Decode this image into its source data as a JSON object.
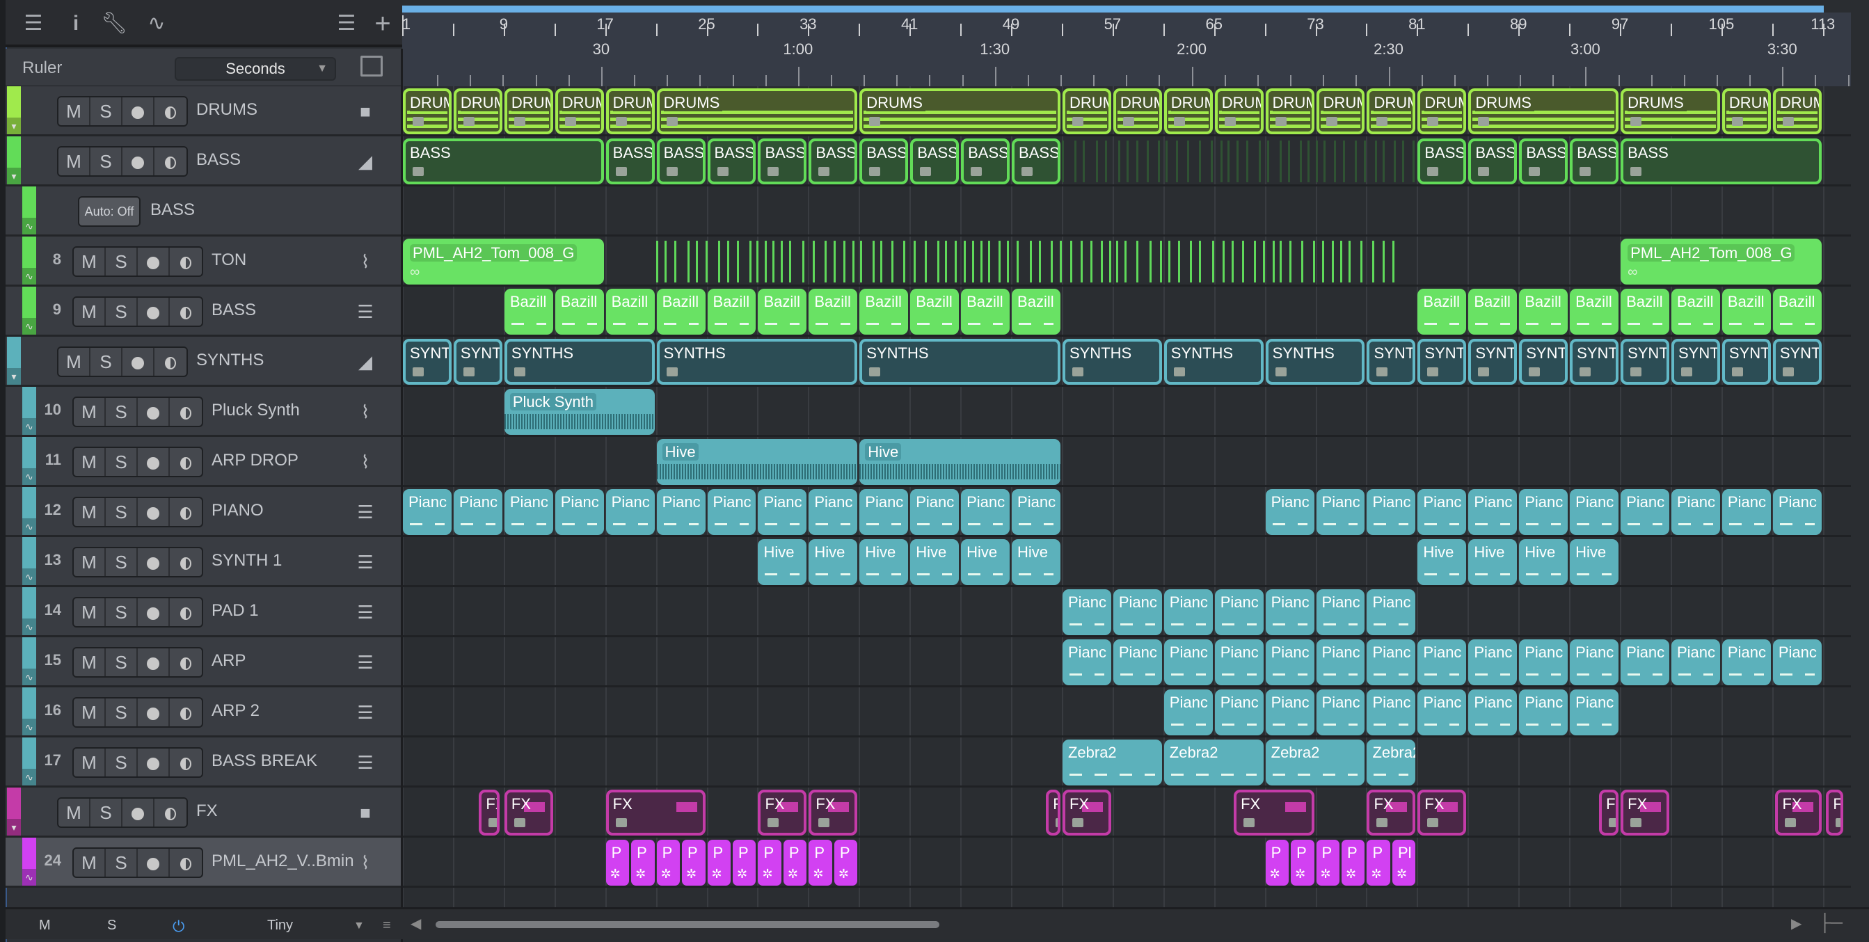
{
  "toolbar": {
    "icons": [
      "menu-icon",
      "info-icon",
      "wrench-icon",
      "automation-icon",
      "list-icon",
      "add-icon"
    ]
  },
  "ruler": {
    "label": "Ruler",
    "format": "Seconds",
    "bar_labels": [
      "1",
      "9",
      "17",
      "25",
      "33",
      "41",
      "49",
      "57",
      "65",
      "73",
      "81",
      "89",
      "97",
      "105",
      "113"
    ],
    "time_labels": [
      {
        "t": 30,
        "label": "30"
      },
      {
        "t": 60,
        "label": "1:00"
      },
      {
        "t": 90,
        "label": "1:30"
      },
      {
        "t": 120,
        "label": "2:00"
      },
      {
        "t": 150,
        "label": "2:30"
      },
      {
        "t": 180,
        "label": "3:00"
      },
      {
        "t": 210,
        "label": "3:30"
      }
    ]
  },
  "colors": {
    "drums": "#a0ea4c",
    "bass": "#62dc58",
    "synths": "#5cb1bb",
    "fx": "#c43ba8",
    "pattern": "#d241f2",
    "loop": "#6ab0e6"
  },
  "tracks": [
    {
      "name": "DRUMS",
      "kind": "folder",
      "icon": "folder-icon",
      "color": "#a0ea4c",
      "style": "c-drums",
      "clips": [
        {
          "label": "DRUMS",
          "start": 1,
          "len": 4,
          "count": 5
        },
        {
          "label": "DRUMS",
          "start": 21,
          "len": 16
        },
        {
          "label": "DRUMS",
          "start": 37,
          "len": 16
        },
        {
          "label": "DRUMS",
          "start": 53,
          "len": 4,
          "count": 8
        },
        {
          "label": "DRUMS",
          "start": 85,
          "len": 12
        },
        {
          "label": "DRUMS",
          "start": 97,
          "len": 8
        },
        {
          "label": "DRUMS",
          "start": 105,
          "len": 4,
          "count": 2
        }
      ]
    },
    {
      "name": "BASS",
      "kind": "folder",
      "icon": "folder-open-icon",
      "color": "#62dc58",
      "style": "c-bass",
      "hits": [
        53,
        81
      ],
      "clips": [
        {
          "label": "BASS",
          "start": 1,
          "len": 16
        },
        {
          "label": "BASS",
          "start": 17,
          "len": 4
        },
        {
          "label": "BASS",
          "start": 21,
          "len": 4,
          "count": 8
        },
        {
          "label": "BASS",
          "start": 81,
          "len": 4,
          "count": 4
        },
        {
          "label": "BASS",
          "start": 97,
          "len": 16
        }
      ]
    },
    {
      "name": "BASS",
      "kind": "automation",
      "auto": "Auto: Off",
      "color": "#62dc58",
      "clips": []
    },
    {
      "num": "8",
      "name": "TON",
      "kind": "child",
      "icon": "waveform-icon",
      "color": "#62dc58",
      "style": "c-tom",
      "hits": [
        21,
        80
      ],
      "clips": [
        {
          "label": "PML_AH2_Tom_008_G",
          "start": 1,
          "len": 16
        },
        {
          "label": "PML_AH2_Tom_008_G",
          "start": 97,
          "len": 16
        }
      ]
    },
    {
      "num": "9",
      "name": "BASS",
      "kind": "child",
      "icon": "keyboard-icon",
      "color": "#62dc58",
      "style": "c-ginst",
      "clips": [
        {
          "label": "Bazill",
          "start": 9,
          "len": 4,
          "count": 11
        },
        {
          "label": "Bazill",
          "start": 81,
          "len": 4,
          "count": 8
        }
      ]
    },
    {
      "name": "SYNTHS",
      "kind": "folder",
      "icon": "folder-open-icon",
      "color": "#5cb1bb",
      "style": "c-synth",
      "clips": [
        {
          "label": "SYNTHS",
          "start": 1,
          "len": 4,
          "count": 2
        },
        {
          "label": "SYNTHS",
          "start": 9,
          "len": 12
        },
        {
          "label": "SYNTHS",
          "start": 21,
          "len": 16
        },
        {
          "label": "SYNTHS",
          "start": 37,
          "len": 16
        },
        {
          "label": "SYNTHS",
          "start": 53,
          "len": 8
        },
        {
          "label": "SYNTHS",
          "start": 61,
          "len": 8
        },
        {
          "label": "SYNTHS",
          "start": 69,
          "len": 8
        },
        {
          "label": "SYNTHS",
          "start": 77,
          "len": 4,
          "count": 9
        }
      ]
    },
    {
      "num": "10",
      "name": "Pluck Synth",
      "kind": "child",
      "icon": "waveform-icon",
      "color": "#5cb1bb",
      "style": "c-taud",
      "clips": [
        {
          "label": "Pluck Synth",
          "start": 9,
          "len": 12
        }
      ]
    },
    {
      "num": "11",
      "name": "ARP DROP",
      "kind": "child",
      "icon": "waveform-icon",
      "color": "#5cb1bb",
      "style": "c-taud",
      "clips": [
        {
          "label": "Hive",
          "start": 21,
          "len": 16
        },
        {
          "label": "Hive",
          "start": 37,
          "len": 16
        }
      ]
    },
    {
      "num": "12",
      "name": "PIANO",
      "kind": "child",
      "icon": "keyboard-icon",
      "color": "#5cb1bb",
      "style": "c-tinst",
      "clips": [
        {
          "label": "Pianc",
          "start": 1,
          "len": 4,
          "count": 13
        },
        {
          "label": "Pianc",
          "start": 69,
          "len": 4,
          "count": 11
        }
      ]
    },
    {
      "num": "13",
      "name": "SYNTH 1",
      "kind": "child",
      "icon": "keyboard-icon",
      "color": "#5cb1bb",
      "style": "c-tinst",
      "clips": [
        {
          "label": "Hive",
          "start": 29,
          "len": 4,
          "count": 6
        },
        {
          "label": "Hive",
          "start": 81,
          "len": 4,
          "count": 4
        }
      ]
    },
    {
      "num": "14",
      "name": "PAD 1",
      "kind": "child",
      "icon": "keyboard-icon",
      "color": "#5cb1bb",
      "style": "c-tinst",
      "clips": [
        {
          "label": "Pianc",
          "start": 53,
          "len": 4,
          "count": 7
        }
      ]
    },
    {
      "num": "15",
      "name": "ARP",
      "kind": "child",
      "icon": "keyboard-icon",
      "color": "#5cb1bb",
      "style": "c-tinst",
      "clips": [
        {
          "label": "Pianc",
          "start": 53,
          "len": 4,
          "count": 15
        }
      ]
    },
    {
      "num": "16",
      "name": "ARP 2",
      "kind": "child",
      "icon": "keyboard-icon",
      "color": "#5cb1bb",
      "style": "c-tinst",
      "clips": [
        {
          "label": "Pianc",
          "start": 61,
          "len": 4,
          "count": 9
        }
      ]
    },
    {
      "num": "17",
      "name": "BASS BREAK",
      "kind": "child",
      "icon": "keyboard-icon",
      "color": "#5cb1bb",
      "style": "c-tinst",
      "clips": [
        {
          "label": "Zebra2",
          "start": 53,
          "len": 8
        },
        {
          "label": "Zebra2",
          "start": 61,
          "len": 8
        },
        {
          "label": "Zebra2",
          "start": 69,
          "len": 8
        },
        {
          "label": "Zebra2",
          "start": 77,
          "len": 4
        }
      ]
    },
    {
      "name": "FX",
      "kind": "folder",
      "icon": "folder-icon",
      "color": "#c43ba8",
      "style": "c-fx",
      "clips": [
        {
          "label": "FX",
          "start": 7,
          "len": 1.8
        },
        {
          "label": "FX",
          "start": 9,
          "len": 4
        },
        {
          "label": "FX",
          "start": 17,
          "len": 8
        },
        {
          "label": "FX",
          "start": 29,
          "len": 4
        },
        {
          "label": "FX",
          "start": 33,
          "len": 4
        },
        {
          "label": "FX",
          "start": 51.7,
          "len": 1.3
        },
        {
          "label": "FX",
          "start": 53,
          "len": 4
        },
        {
          "label": "FX",
          "start": 66.5,
          "len": 6.5
        },
        {
          "label": "FX",
          "start": 77,
          "len": 4
        },
        {
          "label": "FX",
          "start": 81,
          "len": 4
        },
        {
          "label": "FX",
          "start": 95.3,
          "len": 1.7
        },
        {
          "label": "FX",
          "start": 97,
          "len": 4
        },
        {
          "label": "FX",
          "start": 109.2,
          "len": 3.8
        },
        {
          "label": "FX",
          "start": 113.2,
          "len": 1.5
        }
      ]
    },
    {
      "num": "24",
      "name": "PML_AH2_V..Bmin",
      "kind": "child",
      "selected": true,
      "icon": "waveform-icon",
      "color": "#d241f2",
      "style": "c-pat",
      "clips": [
        {
          "label": "P",
          "start": 17,
          "len": 2,
          "count": 10
        },
        {
          "label": "P",
          "start": 69,
          "len": 2,
          "count": 5
        },
        {
          "label": "Pl",
          "start": 79,
          "len": 2
        }
      ]
    }
  ],
  "buttons": {
    "mute": "M",
    "solo": "S"
  },
  "footer": {
    "mute": "M",
    "solo": "S",
    "size": "Tiny"
  }
}
